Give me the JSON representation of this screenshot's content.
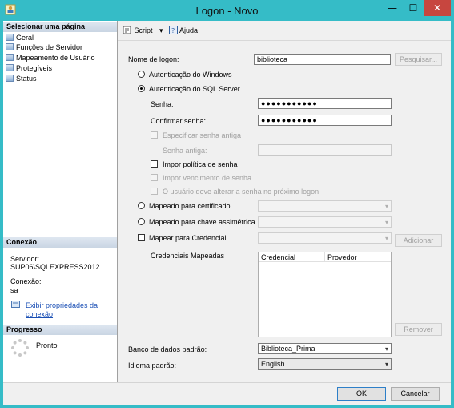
{
  "window": {
    "title": "Logon - Novo",
    "minimize": "—",
    "maximize": "☐",
    "close": "✕"
  },
  "left": {
    "select_page_header": "Selecionar uma página",
    "pages": [
      "Geral",
      "Funções de Servidor",
      "Mapeamento de Usuário",
      "Protegíveis",
      "Status"
    ],
    "connection_header": "Conexão",
    "server_label": "Servidor:",
    "server_value": "SUP06\\SQLEXPRESS2012",
    "connection_label": "Conexão:",
    "connection_value": "sa",
    "view_props_link_line1": "Exibir propriedades da",
    "view_props_link_line2": "conexão",
    "progress_header": "Progresso",
    "progress_status": "Pronto"
  },
  "toolbar": {
    "script": "Script",
    "help": "Ajuda"
  },
  "form": {
    "login_name_label": "Nome de logon:",
    "login_name_value": "biblioteca",
    "search_button": "Pesquisar...",
    "auth_windows": "Autenticação do Windows",
    "auth_sql": "Autenticação do SQL Server",
    "password_label": "Senha:",
    "password_value": "●●●●●●●●●●●",
    "confirm_label": "Confirmar senha:",
    "confirm_value": "●●●●●●●●●●●",
    "specify_old": "Especificar senha antiga",
    "old_password_label": "Senha antiga:",
    "enforce_policy": "Impor política de senha",
    "enforce_expiration": "Impor vencimento de senha",
    "must_change": "O usuário deve alterar a senha no próximo logon",
    "mapped_cert": "Mapeado para certificado",
    "mapped_asym": "Mapeado para chave assimétrica",
    "map_credential": "Mapear para Credencial",
    "add_button": "Adicionar",
    "mapped_credentials": "Credenciais Mapeadas",
    "col_credential": "Credencial",
    "col_provider": "Provedor",
    "remove_button": "Remover",
    "default_db_label": "Banco de dados padrão:",
    "default_db_value": "Biblioteca_Prima",
    "default_lang_label": "Idioma padrão:",
    "default_lang_value": "English"
  },
  "buttons": {
    "ok": "OK",
    "cancel": "Cancelar"
  }
}
